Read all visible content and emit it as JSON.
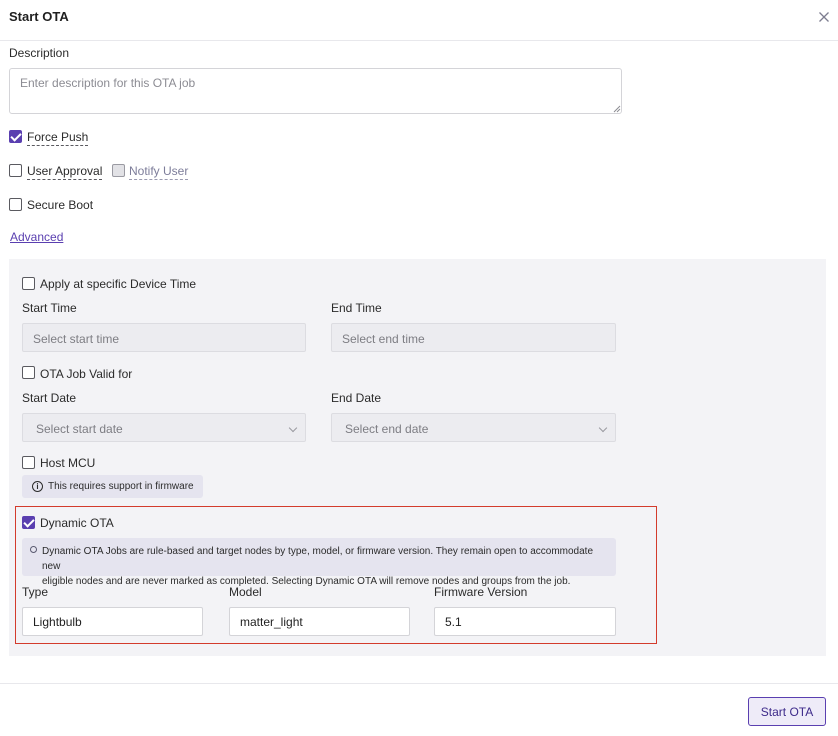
{
  "dialog": {
    "title": "Start OTA"
  },
  "description": {
    "label": "Description",
    "placeholder": "Enter description for this OTA job",
    "value": ""
  },
  "options": {
    "force_push": {
      "label": "Force Push",
      "checked": true
    },
    "user_approval": {
      "label": "User Approval",
      "checked": false
    },
    "notify_user": {
      "label": "Notify User",
      "checked": false,
      "disabled": true
    },
    "secure_boot": {
      "label": "Secure Boot",
      "checked": false
    }
  },
  "advanced": {
    "link": "Advanced",
    "device_time": {
      "label": "Apply at specific Device Time",
      "checked": false
    },
    "start_time": {
      "label": "Start Time",
      "placeholder": "Select start time"
    },
    "end_time": {
      "label": "End Time",
      "placeholder": "Select end time"
    },
    "valid_for": {
      "label": "OTA Job Valid for",
      "checked": false
    },
    "start_date": {
      "label": "Start Date",
      "placeholder": "Select start date"
    },
    "end_date": {
      "label": "End Date",
      "placeholder": "Select end date"
    },
    "host_mcu": {
      "label": "Host MCU",
      "checked": false,
      "info": "This requires support in firmware"
    },
    "dynamic_ota": {
      "label": "Dynamic OTA",
      "checked": true,
      "info_line1": "Dynamic OTA Jobs are rule-based and target nodes by type, model, or firmware version. They remain open to accommodate new",
      "info_line2": "eligible nodes and are never marked as completed. Selecting Dynamic OTA will remove nodes and groups from the job.",
      "type_label": "Type",
      "type_value": "Lightbulb",
      "model_label": "Model",
      "model_value": "matter_light",
      "firmware_label": "Firmware Version",
      "firmware_value": "5.1"
    }
  },
  "footer": {
    "submit_label": "Start OTA"
  },
  "colors": {
    "accent": "#5a3fb0",
    "highlight_border": "#d33b2c",
    "panel_bg": "#f3f3f6"
  }
}
